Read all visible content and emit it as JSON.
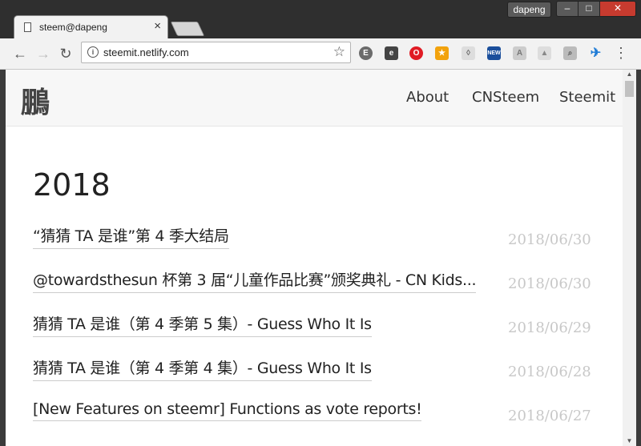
{
  "browser": {
    "tab_title": "steem@dapeng",
    "tab_close": "×",
    "user": "dapeng",
    "win_min": "–",
    "win_max": "□",
    "win_close": "✕",
    "url": "steemit.netlify.com"
  },
  "extensions": [
    "evernote-icon",
    "translate-icon",
    "opera-icon",
    "bookmark-star-icon",
    "shield-icon",
    "new-badge-icon",
    "pdf-icon",
    "drive-icon",
    "search-ext-icon",
    "plane-icon"
  ],
  "site": {
    "logo": "鵬",
    "nav": [
      "About",
      "CNSteem",
      "Steemit"
    ]
  },
  "year": "2018",
  "posts": [
    {
      "title": "“猜猜 TA 是谁”第 4 季大结局",
      "date": "2018/06/30"
    },
    {
      "title": "@towardsthesun 杯第 3 届“儿童作品比赛”颁奖典礼 - CN Kids...",
      "date": "2018/06/30"
    },
    {
      "title": "猜猜 TA 是谁（第 4 季第 5 集）- Guess Who It Is",
      "date": "2018/06/29"
    },
    {
      "title": "猜猜 TA 是谁（第 4 季第 4 集）- Guess Who It Is",
      "date": "2018/06/28"
    },
    {
      "title": "[New Features on steemr] Functions as vote reports!",
      "date": "2018/06/27"
    }
  ]
}
